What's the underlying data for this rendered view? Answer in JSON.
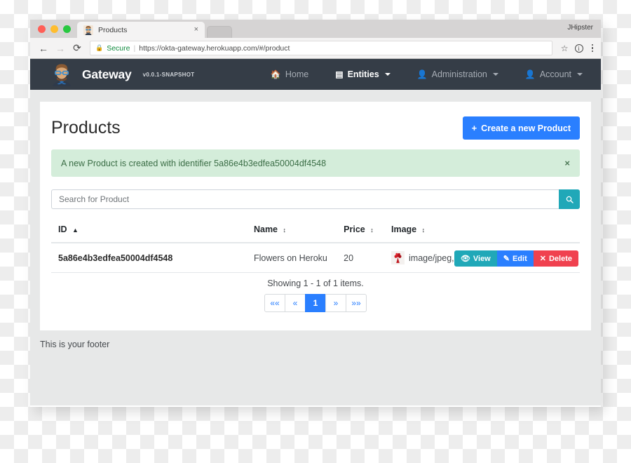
{
  "browser": {
    "tab": {
      "title": "Products",
      "favicon": "jhipster-avatar-icon",
      "close": "×"
    },
    "profile_label": "JHipster",
    "nav": {
      "back": "←",
      "forward": "→",
      "reload": "⟳"
    },
    "address": {
      "lock_icon": "lock-icon",
      "secure_label": "Secure",
      "url": "https://okta-gateway.herokuapp.com/#/product"
    },
    "omni_icons": {
      "bookmark": "☆",
      "info": "i",
      "menu": "kebab-menu-icon"
    }
  },
  "navbar": {
    "brand": "Gateway",
    "version": "v0.0.1-SNAPSHOT",
    "items": [
      {
        "label": "Home",
        "icon": "home-icon",
        "has_caret": false,
        "active": false
      },
      {
        "label": "Entities",
        "icon": "list-icon",
        "has_caret": true,
        "active": true
      },
      {
        "label": "Administration",
        "icon": "user-plus-icon",
        "has_caret": true,
        "active": false
      },
      {
        "label": "Account",
        "icon": "user-icon",
        "has_caret": true,
        "active": false
      }
    ]
  },
  "page": {
    "title": "Products",
    "create_button": {
      "label": "Create a new Product",
      "icon": "plus-icon"
    },
    "alert": {
      "message": "A new Product is created with identifier 5a86e4b3edfea50004df4548",
      "close": "×",
      "color": "#d4edda"
    },
    "search": {
      "placeholder": "Search for Product",
      "value": "",
      "button_icon": "search-icon"
    },
    "table": {
      "columns": [
        {
          "label": "ID",
          "sort": "asc"
        },
        {
          "label": "Name",
          "sort": "none"
        },
        {
          "label": "Price",
          "sort": "none"
        },
        {
          "label": "Image",
          "sort": "none"
        }
      ],
      "rows": [
        {
          "id": "5a86e4b3edfea50004df4548",
          "name": "Flowers on Heroku",
          "price": "20",
          "image_thumb": "flower-bouquet-thumbnail",
          "image_meta": "image/jpeg, 68 053 bytes",
          "actions": [
            {
              "label": "View",
              "icon": "eye-icon",
              "color": "#20a8b8"
            },
            {
              "label": "Edit",
              "icon": "pencil-icon",
              "color": "#2a7fff"
            },
            {
              "label": "Delete",
              "icon": "close-icon",
              "color": "#f0414f"
            }
          ]
        }
      ]
    },
    "showing": "Showing 1 - 1 of 1 items.",
    "pagination": {
      "first": "««",
      "prev": "«",
      "pages": [
        "1"
      ],
      "current": "1",
      "next": "»",
      "last": "»»"
    },
    "footer": "This is your footer"
  }
}
